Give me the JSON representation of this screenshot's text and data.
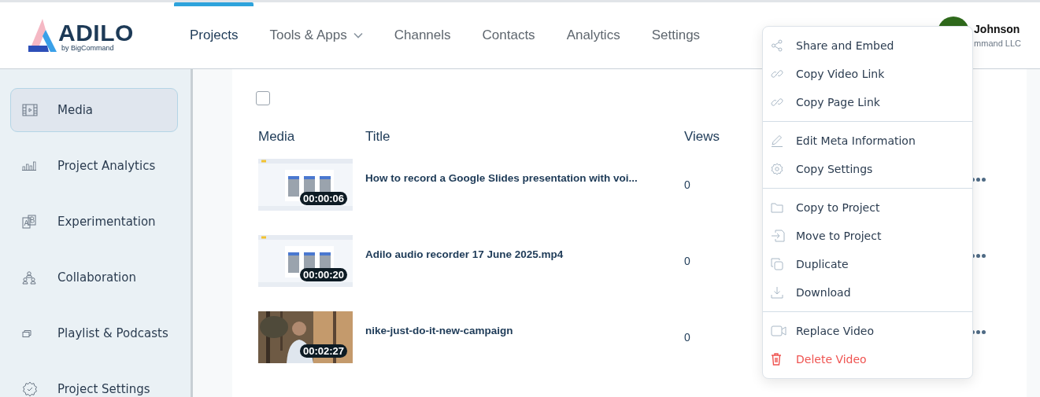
{
  "logo": {
    "name": "ADILO",
    "tagline": "by BigCommand"
  },
  "nav": [
    {
      "label": "Projects",
      "selected": true,
      "dropdown": false
    },
    {
      "label": "Tools & Apps",
      "selected": false,
      "dropdown": true
    },
    {
      "label": "Channels",
      "selected": false,
      "dropdown": false
    },
    {
      "label": "Contacts",
      "selected": false,
      "dropdown": false
    },
    {
      "label": "Analytics",
      "selected": false,
      "dropdown": false
    },
    {
      "label": "Settings",
      "selected": false,
      "dropdown": false
    }
  ],
  "user": {
    "name": "Johnson",
    "company": "mmand LLC"
  },
  "sidebar": {
    "items": [
      {
        "label": "Media",
        "selected": true
      },
      {
        "label": "Project Analytics",
        "selected": false
      },
      {
        "label": "Experimentation",
        "selected": false
      },
      {
        "label": "Collaboration",
        "selected": false
      },
      {
        "label": "Playlist & Podcasts",
        "selected": false
      },
      {
        "label": "Project Settings",
        "selected": false
      }
    ]
  },
  "table": {
    "select_all": {
      "checked": false
    },
    "columns": [
      "Media",
      "Title",
      "Views"
    ],
    "rows": [
      {
        "duration": "00:00:06",
        "title": "How to record a Google Slides presentation with voi...",
        "views": "0"
      },
      {
        "duration": "00:00:20",
        "title": "Adilo audio recorder 17 June 2025.mp4",
        "views": "0"
      },
      {
        "duration": "00:02:27",
        "title": "nike-just-do-it-new-campaign",
        "views": "0"
      }
    ]
  },
  "menu": {
    "groups": [
      [
        {
          "label": "Share and Embed",
          "danger": false
        },
        {
          "label": "Copy Video Link",
          "danger": false
        },
        {
          "label": "Copy Page Link",
          "danger": false
        }
      ],
      [
        {
          "label": "Edit Meta Information",
          "danger": false
        },
        {
          "label": "Copy Settings",
          "danger": false
        }
      ],
      [
        {
          "label": "Copy to Project",
          "danger": false
        },
        {
          "label": "Move to Project",
          "danger": false
        },
        {
          "label": "Duplicate",
          "danger": false
        },
        {
          "label": "Download",
          "danger": false
        }
      ],
      [
        {
          "label": "Replace Video",
          "danger": false
        },
        {
          "label": "Delete Video",
          "danger": true
        }
      ]
    ]
  }
}
